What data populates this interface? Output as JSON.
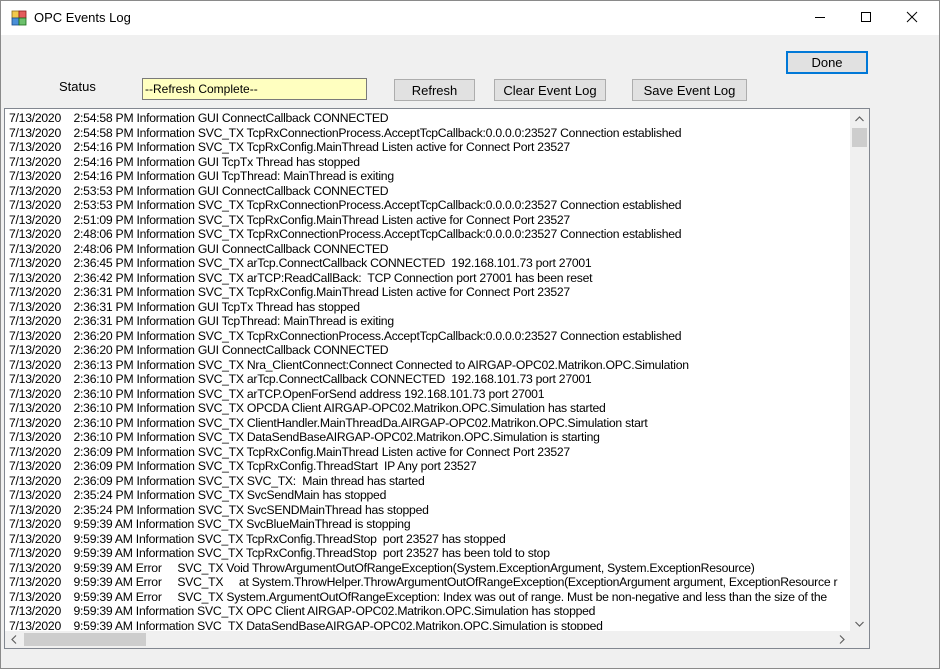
{
  "window": {
    "title": "OPC Events Log"
  },
  "toolbar": {
    "done_label": "Done",
    "status_label": "Status",
    "status_value": "--Refresh Complete--",
    "refresh_label": "Refresh",
    "clear_label": "Clear Event Log",
    "save_label": "Save Event Log"
  },
  "log": {
    "lines": [
      "7/13/2020    2:54:58 PM Information GUI ConnectCallback CONNECTED",
      "7/13/2020    2:54:58 PM Information SVC_TX TcpRxConnectionProcess.AcceptTcpCallback:0.0.0.0:23527 Connection established",
      "7/13/2020    2:54:16 PM Information SVC_TX TcpRxConfig.MainThread Listen active for Connect Port 23527",
      "7/13/2020    2:54:16 PM Information GUI TcpTx Thread has stopped",
      "7/13/2020    2:54:16 PM Information GUI TcpThread: MainThread is exiting",
      "7/13/2020    2:53:53 PM Information GUI ConnectCallback CONNECTED",
      "7/13/2020    2:53:53 PM Information SVC_TX TcpRxConnectionProcess.AcceptTcpCallback:0.0.0.0:23527 Connection established",
      "7/13/2020    2:51:09 PM Information SVC_TX TcpRxConfig.MainThread Listen active for Connect Port 23527",
      "7/13/2020    2:48:06 PM Information SVC_TX TcpRxConnectionProcess.AcceptTcpCallback:0.0.0.0:23527 Connection established",
      "7/13/2020    2:48:06 PM Information GUI ConnectCallback CONNECTED",
      "7/13/2020    2:36:45 PM Information SVC_TX arTcp.ConnectCallback CONNECTED  192.168.101.73 port 27001",
      "7/13/2020    2:36:42 PM Information SVC_TX arTCP:ReadCallBack:  TCP Connection port 27001 has been reset",
      "7/13/2020    2:36:31 PM Information SVC_TX TcpRxConfig.MainThread Listen active for Connect Port 23527",
      "7/13/2020    2:36:31 PM Information GUI TcpTx Thread has stopped",
      "7/13/2020    2:36:31 PM Information GUI TcpThread: MainThread is exiting",
      "7/13/2020    2:36:20 PM Information SVC_TX TcpRxConnectionProcess.AcceptTcpCallback:0.0.0.0:23527 Connection established",
      "7/13/2020    2:36:20 PM Information GUI ConnectCallback CONNECTED",
      "7/13/2020    2:36:13 PM Information SVC_TX Nra_ClientConnect:Connect Connected to AIRGAP-OPC02.Matrikon.OPC.Simulation",
      "7/13/2020    2:36:10 PM Information SVC_TX arTcp.ConnectCallback CONNECTED  192.168.101.73 port 27001",
      "7/13/2020    2:36:10 PM Information SVC_TX arTCP.OpenForSend address 192.168.101.73 port 27001",
      "7/13/2020    2:36:10 PM Information SVC_TX OPCDA Client AIRGAP-OPC02.Matrikon.OPC.Simulation has started",
      "7/13/2020    2:36:10 PM Information SVC_TX ClientHandler.MainThreadDa.AIRGAP-OPC02.Matrikon.OPC.Simulation start",
      "7/13/2020    2:36:10 PM Information SVC_TX DataSendBaseAIRGAP-OPC02.Matrikon.OPC.Simulation is starting",
      "7/13/2020    2:36:09 PM Information SVC_TX TcpRxConfig.MainThread Listen active for Connect Port 23527",
      "7/13/2020    2:36:09 PM Information SVC_TX TcpRxConfig.ThreadStart  IP Any port 23527",
      "7/13/2020    2:36:09 PM Information SVC_TX SVC_TX:  Main thread has started",
      "7/13/2020    2:35:24 PM Information SVC_TX SvcSendMain has stopped",
      "7/13/2020    2:35:24 PM Information SVC_TX SvcSENDMainThread has stopped",
      "7/13/2020    9:59:39 AM Information SVC_TX SvcBlueMainThread is stopping",
      "7/13/2020    9:59:39 AM Information SVC_TX TcpRxConfig.ThreadStop  port 23527 has stopped",
      "7/13/2020    9:59:39 AM Information SVC_TX TcpRxConfig.ThreadStop  port 23527 has been told to stop",
      "7/13/2020    9:59:39 AM Error     SVC_TX Void ThrowArgumentOutOfRangeException(System.ExceptionArgument, System.ExceptionResource)",
      "7/13/2020    9:59:39 AM Error     SVC_TX     at System.ThrowHelper.ThrowArgumentOutOfRangeException(ExceptionArgument argument, ExceptionResource r",
      "7/13/2020    9:59:39 AM Error     SVC_TX System.ArgumentOutOfRangeException: Index was out of range. Must be non-negative and less than the size of the",
      "7/13/2020    9:59:39 AM Information SVC_TX OPC Client AIRGAP-OPC02.Matrikon.OPC.Simulation has stopped",
      "7/13/2020    9:59:39 AM Information SVC_TX DataSendBaseAIRGAP-OPC02.Matrikon.OPC.Simulation is stopped"
    ]
  },
  "icons": {
    "app": "app-icon",
    "minimize": "minimize-icon",
    "maximize": "maximize-icon",
    "close": "close-icon",
    "scroll_up": "chevron-up-icon",
    "scroll_down": "chevron-down-icon",
    "scroll_left": "chevron-left-icon",
    "scroll_right": "chevron-right-icon"
  },
  "colors": {
    "status_field_bg": "#ffffc0",
    "default_button_border": "#0078d7"
  }
}
